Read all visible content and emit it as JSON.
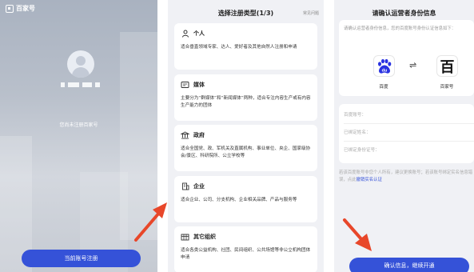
{
  "accent_color": "#3552d8",
  "arrow_color": "#e8472a",
  "panel1": {
    "logo_text": "百家号",
    "status_text": "您尚未注册百家号",
    "register_button": "当前账号注册"
  },
  "panel2": {
    "title": "选择注册类型(1/3)",
    "help_link": "常见问题",
    "types": [
      {
        "icon": "person-icon",
        "title": "个人",
        "desc": "适合垂直领域专家、达人、爱好者及其他自然人注册和申请"
      },
      {
        "icon": "media-icon",
        "title": "媒体",
        "desc": "主要分为“群媒体”和“新闻媒体”两种，适合专注内容生产或有内容生产能力的团体"
      },
      {
        "icon": "government-icon",
        "title": "政府",
        "desc": "适合全国党、政、军机关及直属机构、事业单位、央企、国家级协会/景区、科研院所、公立学校等"
      },
      {
        "icon": "enterprise-icon",
        "title": "企业",
        "desc": "适合企业、公司、分支机构、企业相关品牌、产品与服务等"
      },
      {
        "icon": "organization-icon",
        "title": "其它组织",
        "desc": "适合各类公益机构、社团、民间组织、公共场馆等非公立机构团体申请"
      }
    ]
  },
  "panel3": {
    "title": "请确认运营者身份信息",
    "intro": "请确认运营者身份信息，您的百度账号身份认证信息如下：",
    "baidu_label": "百度",
    "bjh_label": "百家号",
    "bjh_glyph": "百",
    "fields": [
      {
        "label": "百度账号："
      },
      {
        "label": "已绑定姓名："
      },
      {
        "label": "已绑定身份证号："
      }
    ],
    "note_prefix": "若该百度账号非您个人所有，建议更换账号；若该账号绑定实名信息错误，点此",
    "note_link": "撤销实名认证",
    "confirm_button": "确认信息，继续开通"
  }
}
